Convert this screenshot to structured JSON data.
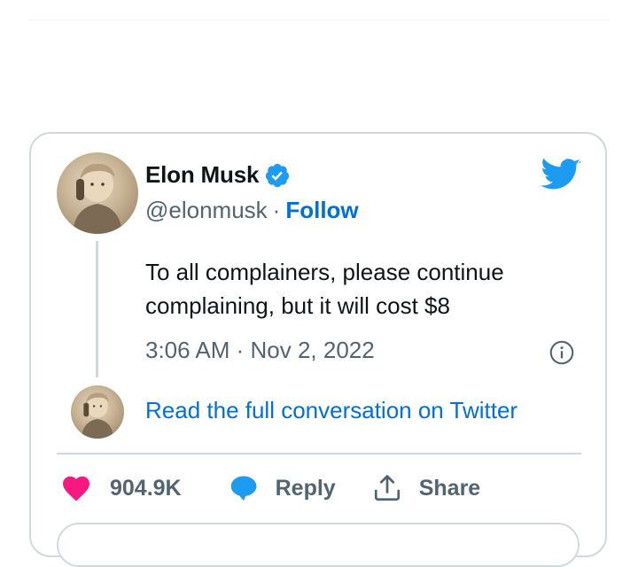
{
  "tweet": {
    "author_name": "Elon Musk",
    "handle": "@elonmusk",
    "separator": "·",
    "follow_label": "Follow",
    "text": "To all complainers, please continue complaining, but it will cost $8",
    "timestamp": "3:06 AM · Nov 2, 2022",
    "read_full_label": "Read the full conversation on Twitter"
  },
  "actions": {
    "likes_count": "904.9K",
    "reply_label": "Reply",
    "share_label": "Share"
  },
  "colors": {
    "link_blue": "#006fd6",
    "verified_blue": "#1d9bf0",
    "like_pink": "#f91880",
    "muted_text": "#536471",
    "border": "#cfd9de"
  },
  "icons": [
    "verified-badge-icon",
    "twitter-bird-icon",
    "info-icon",
    "heart-icon",
    "reply-bubble-icon",
    "share-icon"
  ]
}
